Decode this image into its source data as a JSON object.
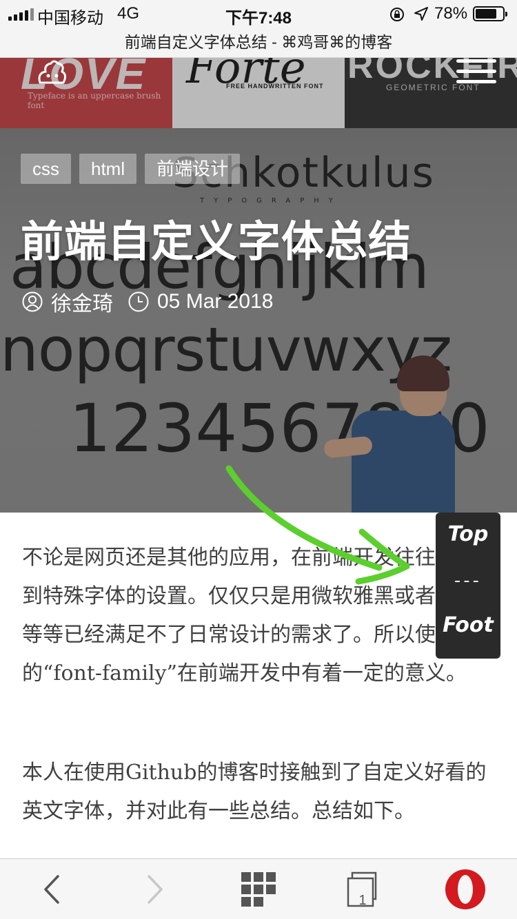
{
  "status_bar": {
    "carrier": "中国移动",
    "network": "4G",
    "time": "下午7:48",
    "battery_percent": "78%",
    "battery_level": 0.78
  },
  "browser": {
    "page_title": "前端自定义字体总结 - ⌘鸡哥⌘的博客",
    "open_tabs": "1"
  },
  "hero": {
    "banner_red_text": "Typeface is an uppercase brush font",
    "banner_white_text": "FREE HANDWRITTEN FONT",
    "banner_dark_big": "ROCKFIRE",
    "banner_dark_text": "GEOMETRIC FONT",
    "wall_line1": "Schkotkulus",
    "wall_line1b": "TYPOGRAPHY",
    "wall_line2": "abcdefghijklm",
    "wall_line3": "nopqrstuvwxyz",
    "wall_line4": "1234567890"
  },
  "post": {
    "tags": [
      "css",
      "html",
      "前端设计"
    ],
    "title": "前端自定义字体总结",
    "author": "徐金琦",
    "date": "05 Mar 2018",
    "paragraphs": [
      " 不论是网页还是其他的应用，在前端开发往往会涉及到特殊字体的设置。仅仅只是用微软雅黑或者是宋体等等已经满足不了日常设计的需求了。所以使用特定的“font-family”在前端开发中有着一定的意义。",
      " 本人在使用Github的博客时接触到了自定义好看的英文字体，并对此有一些总结。总结如下。"
    ]
  },
  "float_nav": {
    "top_label": "Top",
    "separator": "---",
    "foot_label": "Foot"
  },
  "colors": {
    "annotation_arrow": "#5ccf2e",
    "opera_red": "#d21a1f",
    "float_panel_bg": "#2a2a2a"
  },
  "icons": [
    "signal-icon",
    "lock-rotation-icon",
    "location-icon",
    "battery-icon",
    "menu-icon",
    "logo-icon",
    "user-icon",
    "clock-icon",
    "back-icon",
    "forward-icon",
    "speed-dial-icon",
    "tabs-icon",
    "opera-icon"
  ]
}
